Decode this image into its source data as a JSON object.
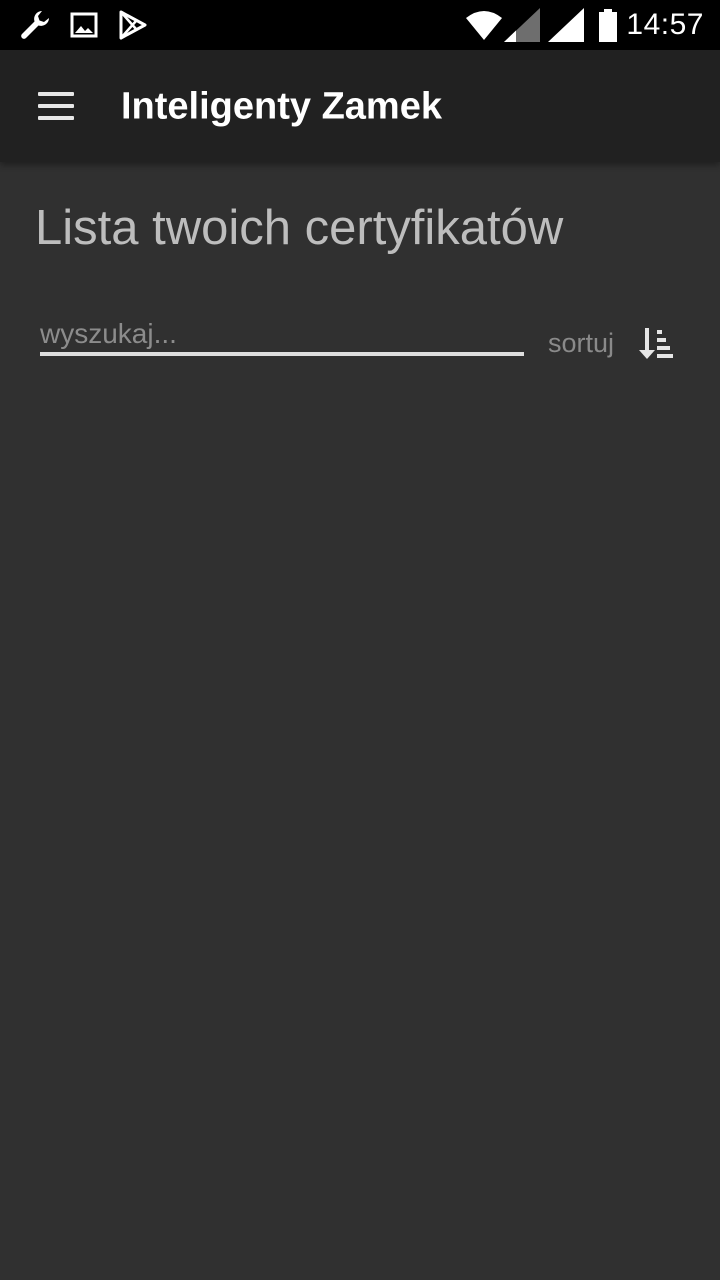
{
  "status_bar": {
    "time": "14:57",
    "icons": [
      "wrench-icon",
      "image-icon",
      "play-store-icon",
      "wifi-icon",
      "signal-icon",
      "signal-icon",
      "battery-icon"
    ]
  },
  "app_bar": {
    "title": "Inteligenty Zamek",
    "menu_icon": "hamburger-menu-icon"
  },
  "main": {
    "title": "Lista twoich certyfikatów",
    "search": {
      "placeholder": "wyszukaj...",
      "value": ""
    },
    "sort": {
      "label": "sortuj",
      "icon": "sort-descending-icon"
    }
  },
  "colors": {
    "status_bar_bg": "#000000",
    "app_bar_bg": "#212121",
    "background": "#303030",
    "title_text": "#bdbdbd",
    "underline": "#dedede"
  }
}
